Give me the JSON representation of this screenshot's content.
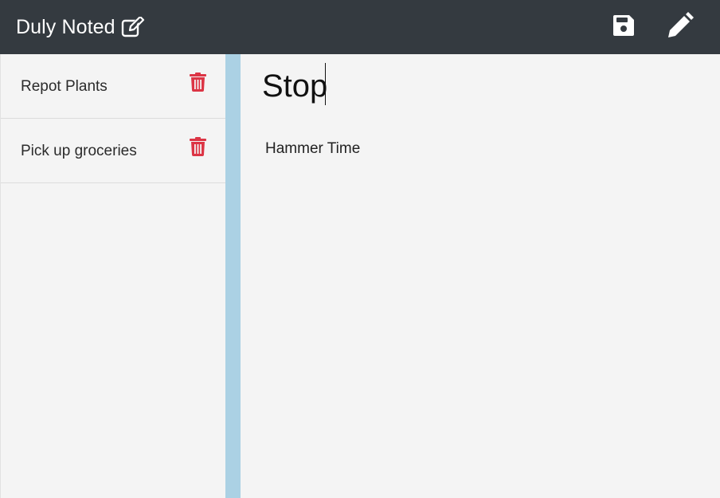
{
  "navbar": {
    "brand": "Duly Noted",
    "brand_icon": "pen-to-square-icon",
    "save_icon": "floppy-disk-icon",
    "edit_icon": "pencil-icon"
  },
  "sidebar": {
    "items": [
      {
        "label": "Repot Plants",
        "delete_icon": "trash-icon"
      },
      {
        "label": "Pick up groceries",
        "delete_icon": "trash-icon"
      }
    ]
  },
  "editor": {
    "title_value": "Stop",
    "body_value": "Hammer Time"
  },
  "colors": {
    "navbar_bg": "#343a40",
    "trash": "#dc3545",
    "divider": "#abd1e4",
    "background": "#f4f4f4"
  }
}
